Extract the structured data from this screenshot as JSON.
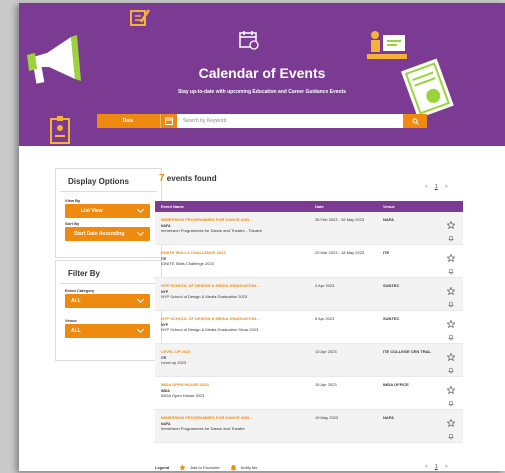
{
  "banner": {
    "title": "Calendar of Events",
    "subtitle": "Stay up-to-date with upcoming Education and Career Guidance Events"
  },
  "search": {
    "date_label": "Date",
    "placeholder": "Search by Keyword"
  },
  "display_options": {
    "heading": "Display Options",
    "view_by_label": "View By",
    "view_by_value": "List View",
    "sort_by_label": "Sort By",
    "sort_by_value": "Start Date Ascending"
  },
  "filter": {
    "heading": "Filter By",
    "category_label": "Event Category",
    "category_value": "ALL",
    "venue_label": "Venue",
    "venue_value": "ALL"
  },
  "results": {
    "count": "7",
    "found_text": "events found",
    "page": "1"
  },
  "table": {
    "headers": {
      "name": "Event Name",
      "date": "Date",
      "venue": "Venue"
    },
    "rows": [
      {
        "name": "IMMERSION PROGRAMMES FOR DANCE AND...",
        "org": "NAFA",
        "sub": "Immersion Programmes for Dance and Theatre - Theatre",
        "date": "26 Feb 2023 - 26 May 2023",
        "venue": "NAFA"
      },
      {
        "name": "IGNITE SKILLS CHALLENGE 2023",
        "org": "ITE",
        "sub": "IGNITE Skills Challenge 2023",
        "date": "20 Mar 2023 - 18 May 2023",
        "venue": "ITE"
      },
      {
        "name": "NYP SCHOOL OF DESIGN & MEDIA GRADUATION...",
        "org": "NYP",
        "sub": "NYP School of Design & Media Graduation 2023",
        "date": "4 Apr 2023",
        "venue": "SUNTEC"
      },
      {
        "name": "NYP SCHOOL OF DESIGN & MEDIA GRADUATION...",
        "org": "NYP",
        "sub": "NYP School of Design & Media Graduation Show 2023",
        "date": "5 Apr 2023",
        "venue": "SUNTEC"
      },
      {
        "name": "LEVEL UP 2023",
        "org": "ITE",
        "sub": "Level up 2023",
        "date": "13 Apr 2023",
        "venue": "ITE COLLEGE CEN TRAL"
      },
      {
        "name": "IMDA OPEN HOUSE 2023",
        "org": "IMDA",
        "sub": "IMDA Open House 2023",
        "date": "15 Apr 2023",
        "venue": "IMDA OFFICE"
      },
      {
        "name": "IMMERSION PROGRAMMES FOR DANCE AND...",
        "org": "NAFA",
        "sub": "Immersion Programmes for Dance and Theatre",
        "date": "19 May 2023",
        "venue": "NAFA"
      }
    ]
  },
  "legend": {
    "label": "Legend",
    "favourite": "Add to Favourite",
    "notify": "Notify Me"
  },
  "colors": {
    "brand_purple": "#7c3b93",
    "accent_orange": "#ee8a10"
  },
  "icons": [
    "megaphone-icon",
    "calendar-icon",
    "presenter-icon",
    "id-badge-icon",
    "certificate-icon",
    "pencil-note-icon",
    "search-icon",
    "star-icon",
    "bell-icon",
    "calendar-small-icon",
    "chevron-down-icon"
  ]
}
